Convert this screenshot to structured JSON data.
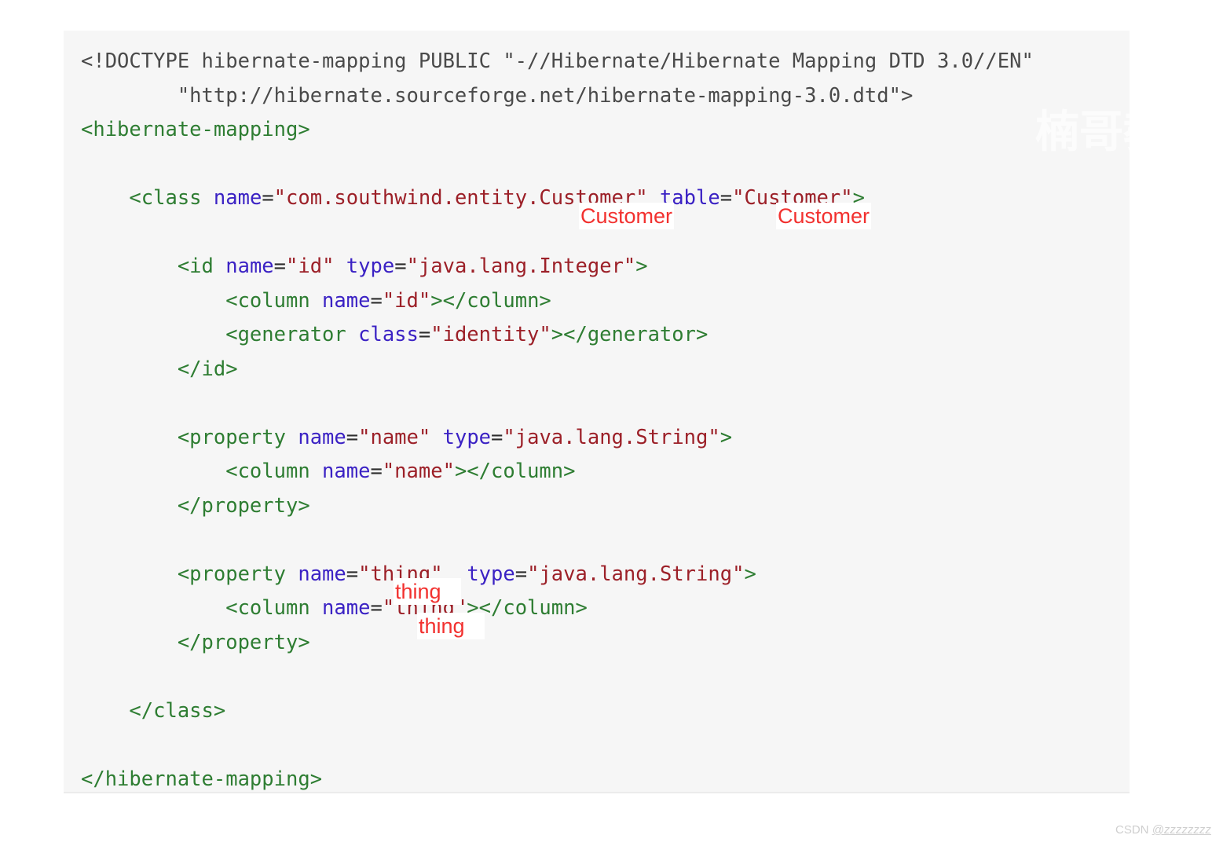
{
  "code_block": {
    "language": "xml",
    "background_color": "#f6f6f6",
    "lines": [
      {
        "indent": 0,
        "tokens": [
          {
            "type": "doctype",
            "text": "<!DOCTYPE hibernate-mapping PUBLIC \"-//Hibernate/Hibernate Mapping DTD 3.0//EN\""
          }
        ]
      },
      {
        "indent": 0,
        "tokens": [
          {
            "type": "doctype",
            "text": "        \"http://hibernate.sourceforge.net/hibernate-mapping-3.0.dtd\">"
          }
        ]
      },
      {
        "indent": 0,
        "tokens": [
          {
            "type": "tag",
            "text": "<hibernate-mapping>"
          }
        ]
      },
      {
        "indent": 0,
        "tokens": [
          {
            "type": "blank",
            "text": ""
          }
        ]
      },
      {
        "indent": 0,
        "tokens": [
          {
            "type": "tag",
            "text": "    <class "
          },
          {
            "type": "attr",
            "text": "name"
          },
          {
            "type": "punct",
            "text": "="
          },
          {
            "type": "val",
            "text": "\"com.southwind.entity.Customer\""
          },
          {
            "type": "punct",
            "text": " "
          },
          {
            "type": "attr",
            "text": "table"
          },
          {
            "type": "punct",
            "text": "="
          },
          {
            "type": "val",
            "text": "\"Customer\""
          },
          {
            "type": "tag",
            "text": ">"
          }
        ]
      },
      {
        "indent": 0,
        "tokens": [
          {
            "type": "blank",
            "text": ""
          }
        ]
      },
      {
        "indent": 0,
        "tokens": [
          {
            "type": "tag",
            "text": "        <id "
          },
          {
            "type": "attr",
            "text": "name"
          },
          {
            "type": "punct",
            "text": "="
          },
          {
            "type": "val",
            "text": "\"id\""
          },
          {
            "type": "punct",
            "text": " "
          },
          {
            "type": "attr",
            "text": "type"
          },
          {
            "type": "punct",
            "text": "="
          },
          {
            "type": "val",
            "text": "\"java.lang.Integer\""
          },
          {
            "type": "tag",
            "text": ">"
          }
        ]
      },
      {
        "indent": 0,
        "tokens": [
          {
            "type": "tag",
            "text": "            <column "
          },
          {
            "type": "attr",
            "text": "name"
          },
          {
            "type": "punct",
            "text": "="
          },
          {
            "type": "val",
            "text": "\"id\""
          },
          {
            "type": "tag",
            "text": "></column>"
          }
        ]
      },
      {
        "indent": 0,
        "tokens": [
          {
            "type": "tag",
            "text": "            <generator "
          },
          {
            "type": "attr",
            "text": "class"
          },
          {
            "type": "punct",
            "text": "="
          },
          {
            "type": "val",
            "text": "\"identity\""
          },
          {
            "type": "tag",
            "text": "></generator>"
          }
        ]
      },
      {
        "indent": 0,
        "tokens": [
          {
            "type": "tag",
            "text": "        </id>"
          }
        ]
      },
      {
        "indent": 0,
        "tokens": [
          {
            "type": "blank",
            "text": ""
          }
        ]
      },
      {
        "indent": 0,
        "tokens": [
          {
            "type": "tag",
            "text": "        <property "
          },
          {
            "type": "attr",
            "text": "name"
          },
          {
            "type": "punct",
            "text": "="
          },
          {
            "type": "val",
            "text": "\"name\""
          },
          {
            "type": "punct",
            "text": " "
          },
          {
            "type": "attr",
            "text": "type"
          },
          {
            "type": "punct",
            "text": "="
          },
          {
            "type": "val",
            "text": "\"java.lang.String\""
          },
          {
            "type": "tag",
            "text": ">"
          }
        ]
      },
      {
        "indent": 0,
        "tokens": [
          {
            "type": "tag",
            "text": "            <column "
          },
          {
            "type": "attr",
            "text": "name"
          },
          {
            "type": "punct",
            "text": "="
          },
          {
            "type": "val",
            "text": "\"name\""
          },
          {
            "type": "tag",
            "text": "></column>"
          }
        ]
      },
      {
        "indent": 0,
        "tokens": [
          {
            "type": "tag",
            "text": "        </property>"
          }
        ]
      },
      {
        "indent": 0,
        "tokens": [
          {
            "type": "blank",
            "text": ""
          }
        ]
      },
      {
        "indent": 0,
        "tokens": [
          {
            "type": "tag",
            "text": "        <property "
          },
          {
            "type": "attr",
            "text": "name"
          },
          {
            "type": "punct",
            "text": "="
          },
          {
            "type": "val",
            "text": "\"thing\""
          },
          {
            "type": "punct",
            "text": "  "
          },
          {
            "type": "attr",
            "text": "type"
          },
          {
            "type": "punct",
            "text": "="
          },
          {
            "type": "val",
            "text": "\"java.lang.String\""
          },
          {
            "type": "tag",
            "text": ">"
          }
        ]
      },
      {
        "indent": 0,
        "tokens": [
          {
            "type": "tag",
            "text": "            <column "
          },
          {
            "type": "attr",
            "text": "name"
          },
          {
            "type": "punct",
            "text": "="
          },
          {
            "type": "val",
            "text": "\"thing\""
          },
          {
            "type": "tag",
            "text": "></column>"
          }
        ]
      },
      {
        "indent": 0,
        "tokens": [
          {
            "type": "tag",
            "text": "        </property>"
          }
        ]
      },
      {
        "indent": 0,
        "tokens": [
          {
            "type": "blank",
            "text": ""
          }
        ]
      },
      {
        "indent": 0,
        "tokens": [
          {
            "type": "tag",
            "text": "    </class>"
          }
        ]
      },
      {
        "indent": 0,
        "tokens": [
          {
            "type": "blank",
            "text": ""
          }
        ]
      },
      {
        "indent": 0,
        "tokens": [
          {
            "type": "tag",
            "text": "</hibernate-mapping>"
          }
        ]
      }
    ]
  },
  "annotations": {
    "color": "#f2312f",
    "highlight_background": "#ffffff",
    "items": [
      {
        "id": "class-customer",
        "text": "Customer",
        "target": "class name attribute value suffix"
      },
      {
        "id": "table-customer",
        "text": "Customer",
        "target": "table attribute value"
      },
      {
        "id": "property-thing",
        "text": "thing",
        "target": "property name attribute value"
      },
      {
        "id": "column-thing",
        "text": "thing",
        "target": "column name attribute value"
      }
    ]
  },
  "watermark": {
    "text": "楠哥教",
    "color": "#ffffff"
  },
  "footer": {
    "brand": "CSDN ",
    "handle": "@zzzzzzzz",
    "color": "#cfcfcf"
  },
  "syntax_colors": {
    "doctype": "#4a4a4a",
    "tag": "#2e7d32",
    "attribute": "#3b22c4",
    "value": "#9c2028",
    "punctuation": "#2e2e2e"
  }
}
